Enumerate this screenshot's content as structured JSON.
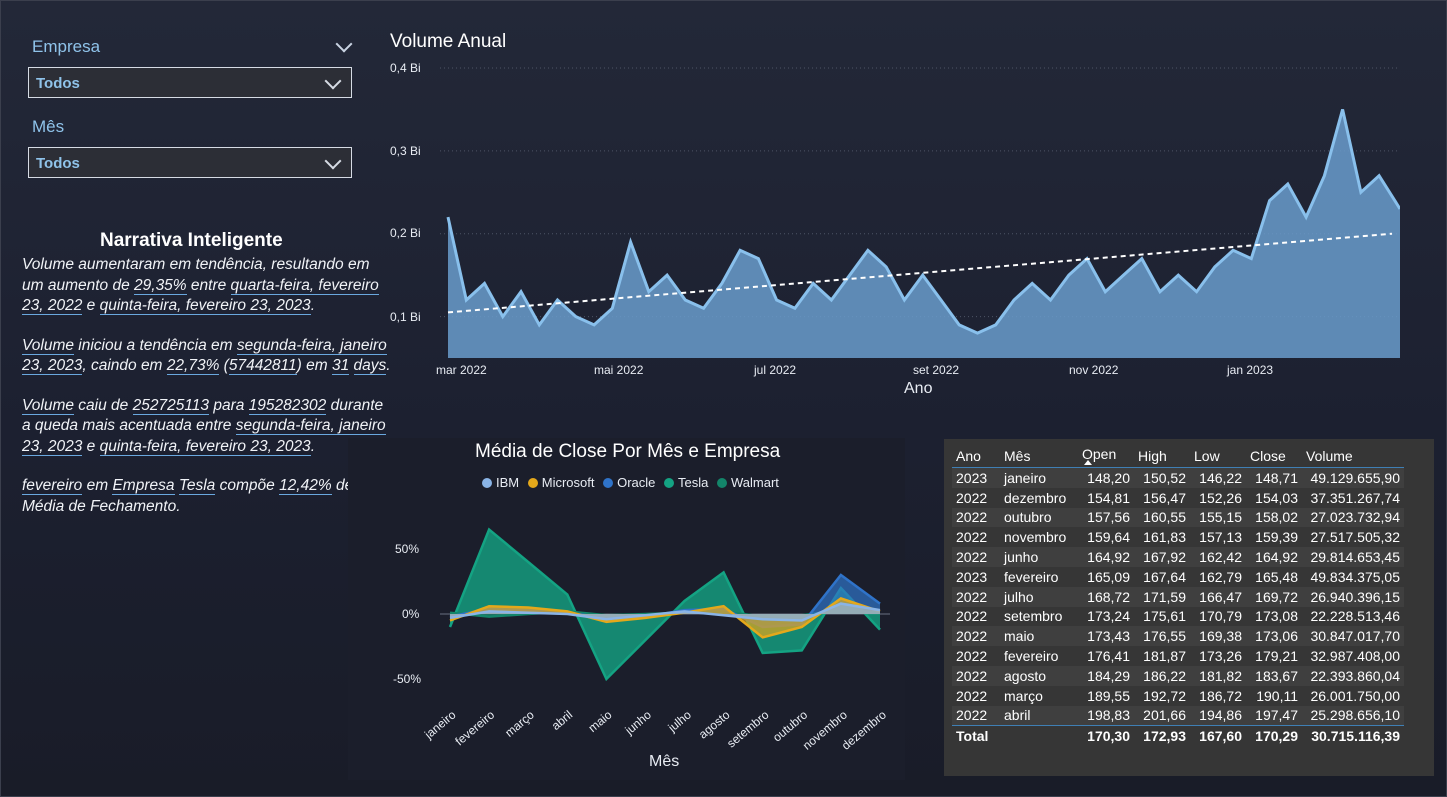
{
  "filters": {
    "empresa": {
      "label": "Empresa",
      "value": "Todos"
    },
    "mes": {
      "label": "Mês",
      "value": "Todos"
    }
  },
  "narrative": {
    "title": "Narrativa Inteligente",
    "p1": [
      "Volume aumentaram em tendência, resultando em um aumento de ",
      "29,35%",
      " entre ",
      "quarta-feira, fevereiro 23, 2022",
      " e ",
      "quinta-feira, fevereiro 23, 2023",
      "."
    ],
    "p2": [
      "Volume",
      " iniciou a tendência em ",
      "segunda-feira, janeiro 23, 2023",
      ", caindo em ",
      "22,73%",
      " (",
      "57442811",
      ") em ",
      "31",
      " ",
      "days",
      "."
    ],
    "p3": [
      "Volume",
      " caiu de ",
      "252725113",
      " para ",
      "195282302",
      " durante a queda mais acentuada entre ",
      "segunda-feira, janeiro 23, 2023",
      " e ",
      "quinta-feira, fevereiro 23, 2023",
      "."
    ],
    "p4": [
      "fevereiro",
      " em ",
      "Empresa",
      " ",
      "Tesla",
      " compõe ",
      "12,42%",
      " de Média de Fechamento."
    ]
  },
  "volume_chart": {
    "title": "Volume Anual",
    "y_ticks": [
      "0,4 Bi",
      "0,3 Bi",
      "0,2 Bi",
      "0,1 Bi"
    ],
    "x_ticks": [
      "mar 2022",
      "mai 2022",
      "jul 2022",
      "set 2022",
      "nov 2022",
      "jan 2023"
    ],
    "xlabel": "Ano",
    "colors": {
      "area": "#6a9ccd",
      "line": "#89c0ec",
      "trend": "#ffffff"
    }
  },
  "close_chart": {
    "title": "Média de Close Por Mês e Empresa",
    "y_ticks": [
      "50%",
      "0%",
      "-50%"
    ],
    "xlabel": "Mês",
    "legend": [
      {
        "name": "IBM",
        "color": "#8ab4e6"
      },
      {
        "name": "Microsoft",
        "color": "#e4a81b"
      },
      {
        "name": "Oracle",
        "color": "#2f73c9"
      },
      {
        "name": "Tesla",
        "color": "#14a383"
      },
      {
        "name": "Walmart",
        "color": "#13856a"
      }
    ],
    "months": [
      "janeiro",
      "fevereiro",
      "março",
      "abril",
      "maio",
      "junho",
      "julho",
      "agosto",
      "setembro",
      "outubro",
      "novembro",
      "dezembro"
    ]
  },
  "chart_data": [
    {
      "type": "area",
      "title": "Volume Anual",
      "xlabel": "Ano",
      "ylabel": "",
      "x_range": [
        "2022-02-23",
        "2023-02-23"
      ],
      "ylim": [
        0.05,
        0.4
      ],
      "y_unit": "Bi",
      "grid": true,
      "trendline": {
        "start": 0.105,
        "end": 0.2
      },
      "series": [
        {
          "x": [
            "2022-02-23",
            "2022-03-02",
            "2022-03-09",
            "2022-03-16",
            "2022-03-23",
            "2022-03-30",
            "2022-04-06",
            "2022-04-13",
            "2022-04-20",
            "2022-04-27",
            "2022-05-04",
            "2022-05-11",
            "2022-05-18",
            "2022-05-25",
            "2022-06-01",
            "2022-06-08",
            "2022-06-15",
            "2022-06-22",
            "2022-06-29",
            "2022-07-06",
            "2022-07-13",
            "2022-07-20",
            "2022-07-27",
            "2022-08-03",
            "2022-08-10",
            "2022-08-17",
            "2022-08-24",
            "2022-08-31",
            "2022-09-07",
            "2022-09-14",
            "2022-09-21",
            "2022-09-28",
            "2022-10-05",
            "2022-10-12",
            "2022-10-19",
            "2022-10-26",
            "2022-11-02",
            "2022-11-09",
            "2022-11-16",
            "2022-11-23",
            "2022-11-30",
            "2022-12-07",
            "2022-12-14",
            "2022-12-21",
            "2022-12-28",
            "2023-01-04",
            "2023-01-11",
            "2023-01-18",
            "2023-01-25",
            "2023-02-01",
            "2023-02-08",
            "2023-02-15",
            "2023-02-23"
          ],
          "values": [
            0.22,
            0.12,
            0.14,
            0.1,
            0.13,
            0.09,
            0.12,
            0.1,
            0.09,
            0.11,
            0.19,
            0.13,
            0.15,
            0.12,
            0.11,
            0.14,
            0.18,
            0.17,
            0.12,
            0.11,
            0.14,
            0.12,
            0.15,
            0.18,
            0.16,
            0.12,
            0.15,
            0.12,
            0.09,
            0.08,
            0.09,
            0.12,
            0.14,
            0.12,
            0.15,
            0.17,
            0.13,
            0.15,
            0.17,
            0.13,
            0.15,
            0.13,
            0.16,
            0.18,
            0.17,
            0.24,
            0.26,
            0.22,
            0.27,
            0.35,
            0.25,
            0.27,
            0.23
          ]
        }
      ]
    },
    {
      "type": "area",
      "title": "Média de Close Por Mês e Empresa",
      "xlabel": "Mês",
      "ylabel": "",
      "ylim": [
        -60,
        70
      ],
      "y_unit": "%",
      "categories": [
        "janeiro",
        "fevereiro",
        "março",
        "abril",
        "maio",
        "junho",
        "julho",
        "agosto",
        "setembro",
        "outubro",
        "novembro",
        "dezembro"
      ],
      "series": [
        {
          "name": "IBM",
          "values": [
            -3,
            2,
            1,
            0,
            -4,
            -1,
            2,
            -1,
            -4,
            -5,
            8,
            3
          ]
        },
        {
          "name": "Microsoft",
          "values": [
            -5,
            6,
            5,
            2,
            -6,
            -3,
            1,
            6,
            -18,
            -10,
            12,
            2
          ]
        },
        {
          "name": "Oracle",
          "values": [
            -2,
            4,
            3,
            1,
            -3,
            -2,
            3,
            4,
            -10,
            -8,
            30,
            8
          ]
        },
        {
          "name": "Tesla",
          "values": [
            -10,
            65,
            40,
            15,
            -50,
            -20,
            10,
            32,
            -30,
            -28,
            20,
            -12
          ]
        },
        {
          "name": "Walmart",
          "values": [
            1,
            -2,
            0,
            2,
            -1,
            0,
            1,
            2,
            -2,
            -1,
            3,
            1
          ]
        }
      ]
    },
    {
      "type": "table",
      "columns": [
        "Ano",
        "Mês",
        "Open",
        "High",
        "Low",
        "Close",
        "Volume"
      ],
      "rows": [
        [
          "2023",
          "janeiro",
          "148,20",
          "150,52",
          "146,22",
          "148,71",
          "49.129.655,90"
        ],
        [
          "2022",
          "dezembro",
          "154,81",
          "156,47",
          "152,26",
          "154,03",
          "37.351.267,74"
        ],
        [
          "2022",
          "outubro",
          "157,56",
          "160,55",
          "155,15",
          "158,02",
          "27.023.732,94"
        ],
        [
          "2022",
          "novembro",
          "159,64",
          "161,83",
          "157,13",
          "159,39",
          "27.517.505,32"
        ],
        [
          "2022",
          "junho",
          "164,92",
          "167,92",
          "162,42",
          "164,92",
          "29.814.653,45"
        ],
        [
          "2023",
          "fevereiro",
          "165,09",
          "167,64",
          "162,79",
          "165,48",
          "49.834.375,05"
        ],
        [
          "2022",
          "julho",
          "168,72",
          "171,59",
          "166,47",
          "169,72",
          "26.940.396,15"
        ],
        [
          "2022",
          "setembro",
          "173,24",
          "175,61",
          "170,79",
          "173,08",
          "22.228.513,46"
        ],
        [
          "2022",
          "maio",
          "173,43",
          "176,55",
          "169,38",
          "173,06",
          "30.847.017,70"
        ],
        [
          "2022",
          "fevereiro",
          "176,41",
          "181,87",
          "173,26",
          "179,21",
          "32.987.408,00"
        ],
        [
          "2022",
          "agosto",
          "184,29",
          "186,22",
          "181,82",
          "183,67",
          "22.393.860,04"
        ],
        [
          "2022",
          "março",
          "189,55",
          "192,72",
          "186,72",
          "190,11",
          "26.001.750,00"
        ],
        [
          "2022",
          "abril",
          "198,83",
          "201,66",
          "194,86",
          "197,47",
          "25.298.656,10"
        ]
      ],
      "total": [
        "Total",
        "",
        "170,30",
        "172,93",
        "167,60",
        "170,29",
        "30.715.116,39"
      ]
    }
  ]
}
